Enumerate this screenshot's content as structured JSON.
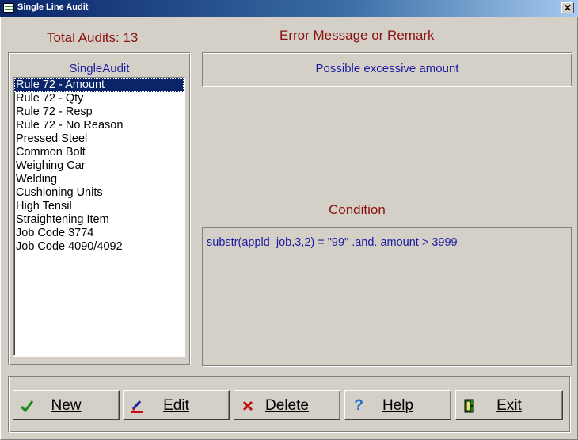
{
  "window": {
    "title": "Single Line Audit",
    "close_glyph": "✕"
  },
  "summary": {
    "total_audits": "Total Audits: 13"
  },
  "audit_list": {
    "heading": "SingleAudit",
    "items": [
      "Rule 72 - Amount",
      "Rule 72 - Qty",
      "Rule 72 - Resp",
      "Rule 72 - No Reason",
      "Pressed Steel",
      "Common Bolt",
      "Weighing Car",
      "Welding",
      "Cushioning Units",
      "High Tensil",
      "Straightening Item",
      "Job Code 3774",
      "Job Code 4090/4092"
    ],
    "selected_index": 0
  },
  "error_section": {
    "heading": "Error Message or Remark",
    "message": "Possible excessive amount"
  },
  "condition_section": {
    "heading": "Condition",
    "expression": "substr(appld  job,3,2) = \"99\" .and. amount > 3999"
  },
  "buttons": {
    "new": {
      "label": "New",
      "icon": "checkmark-icon",
      "color": "#1a8a1a"
    },
    "edit": {
      "label": "Edit",
      "icon": "pencil-icon",
      "color": "#1c1ca0"
    },
    "delete": {
      "label": "Delete",
      "icon": "x-icon",
      "color": "#c01010"
    },
    "help": {
      "label": "Help",
      "icon": "question-icon",
      "color": "#1a6ec8"
    },
    "exit": {
      "label": "Exit",
      "icon": "door-icon",
      "color": "#1a8a1a"
    }
  },
  "colors": {
    "heading_red": "#8b1010",
    "text_blue": "#1c1ca0",
    "face": "#d4d0c8",
    "selection": "#0a246a"
  }
}
